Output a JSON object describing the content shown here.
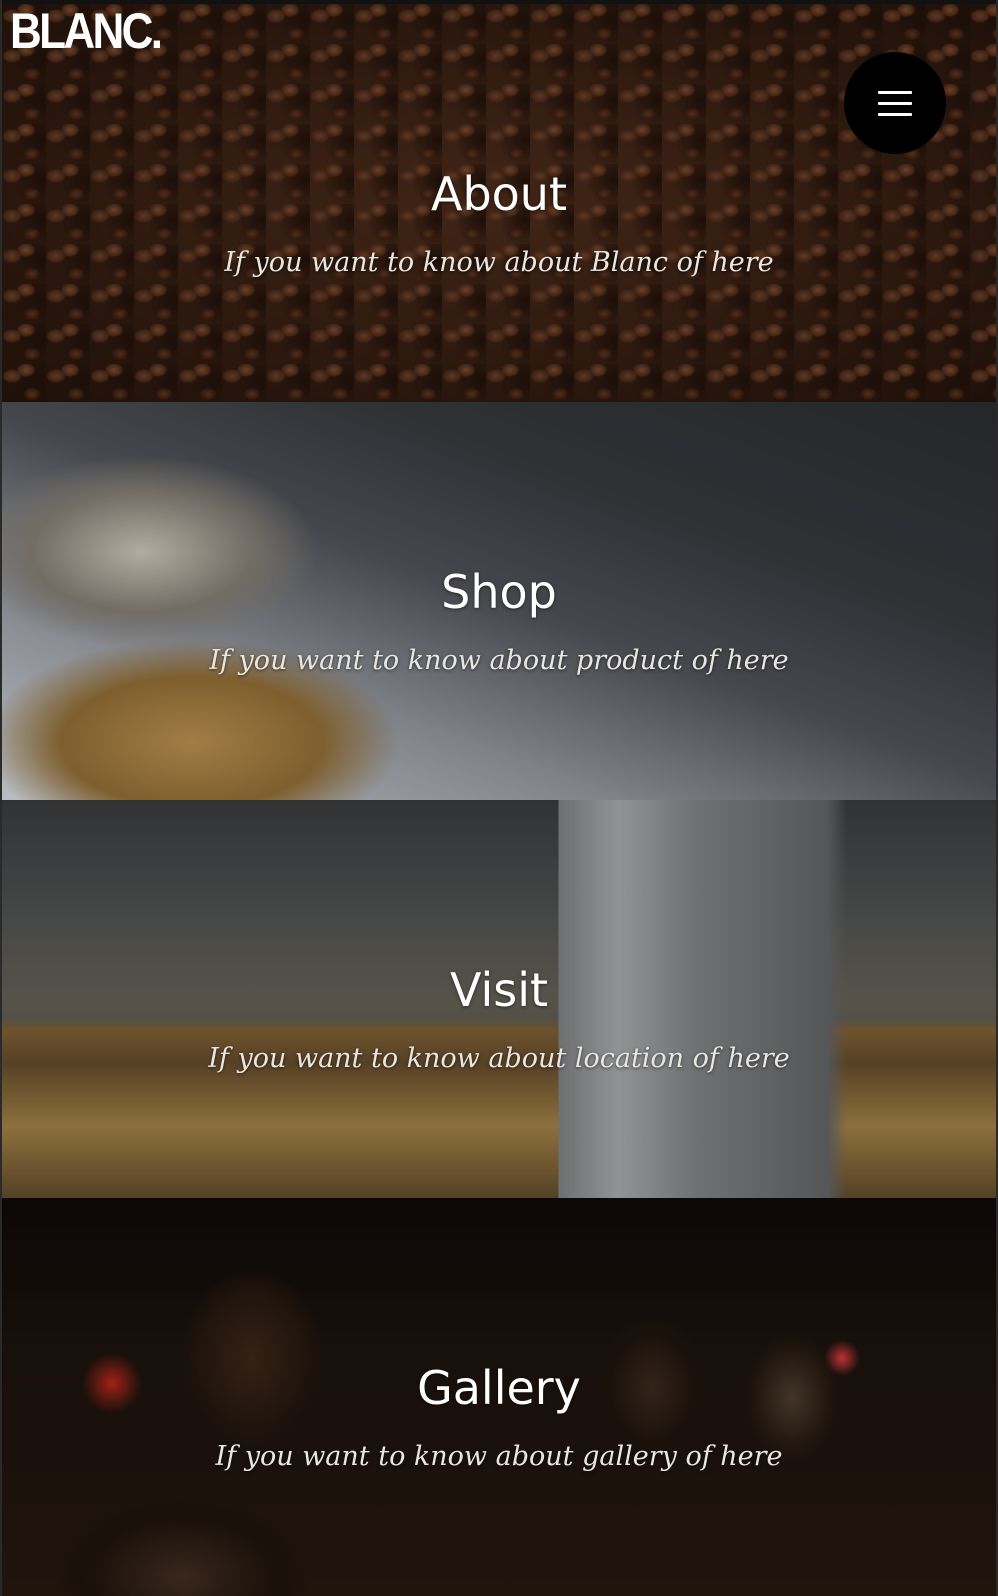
{
  "header": {
    "logo": "BLANC.",
    "menu_icon": "hamburger-menu-icon"
  },
  "sections": [
    {
      "title": "About",
      "subtitle": "If you want to know about Blanc of here"
    },
    {
      "title": "Shop",
      "subtitle": "If you want to know about product of here"
    },
    {
      "title": "Visit",
      "subtitle": "If you want to know about location of here"
    },
    {
      "title": "Gallery",
      "subtitle": "If you want to know about gallery of here"
    }
  ]
}
